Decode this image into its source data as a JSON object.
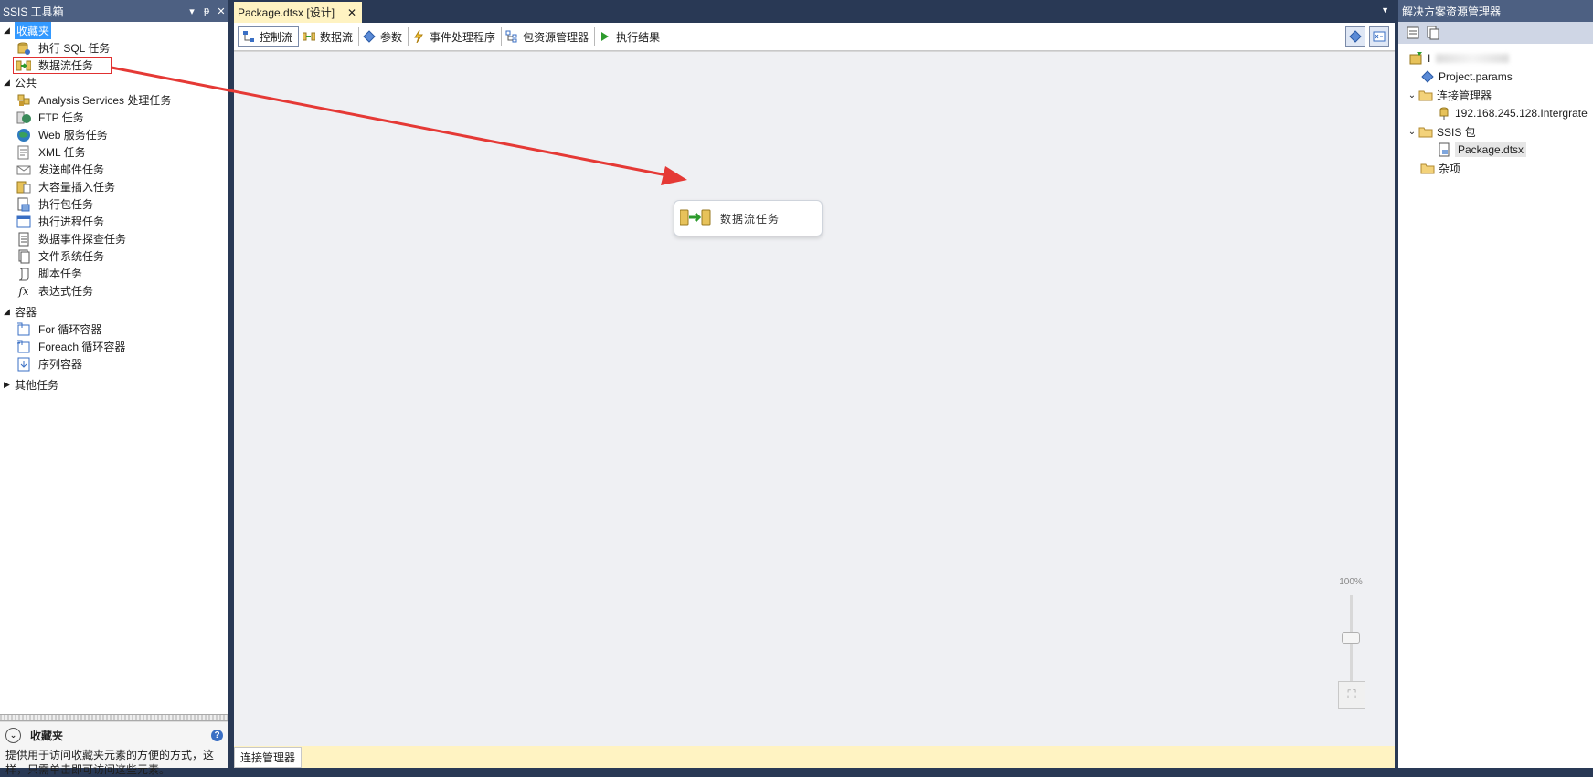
{
  "toolbox": {
    "title": "SSIS 工具箱",
    "favorites": {
      "label": "收藏夹",
      "items": [
        {
          "label": "执行 SQL 任务",
          "icon": "sql-task-icon"
        },
        {
          "label": "数据流任务",
          "icon": "data-flow-task-icon"
        }
      ]
    },
    "common": {
      "label": "公共",
      "items": [
        {
          "label": "Analysis Services 处理任务",
          "icon": "analysis-services-icon"
        },
        {
          "label": "FTP 任务",
          "icon": "ftp-icon"
        },
        {
          "label": "Web 服务任务",
          "icon": "web-service-icon"
        },
        {
          "label": "XML 任务",
          "icon": "xml-icon"
        },
        {
          "label": "发送邮件任务",
          "icon": "mail-icon"
        },
        {
          "label": "大容量插入任务",
          "icon": "bulk-insert-icon"
        },
        {
          "label": "执行包任务",
          "icon": "execute-package-icon"
        },
        {
          "label": "执行进程任务",
          "icon": "execute-process-icon"
        },
        {
          "label": "数据事件探查任务",
          "icon": "data-profiling-icon"
        },
        {
          "label": "文件系统任务",
          "icon": "file-system-icon"
        },
        {
          "label": "脚本任务",
          "icon": "script-icon"
        },
        {
          "label": "表达式任务",
          "icon": "expression-icon"
        }
      ]
    },
    "containers": {
      "label": "容器",
      "items": [
        {
          "label": "For 循环容器",
          "icon": "for-loop-icon"
        },
        {
          "label": "Foreach 循环容器",
          "icon": "foreach-loop-icon"
        },
        {
          "label": "序列容器",
          "icon": "sequence-container-icon"
        }
      ]
    },
    "other": {
      "label": "其他任务"
    },
    "description": {
      "title": "收藏夹",
      "text": "提供用于访问收藏夹元素的方便的方式，这样，只需单击即可访问这些元素。"
    }
  },
  "document": {
    "tab_title": "Package.dtsx [设计]",
    "designer_tabs": [
      {
        "label": "控制流",
        "icon": "control-flow-icon",
        "active": true
      },
      {
        "label": "数据流",
        "icon": "data-flow-icon"
      },
      {
        "label": "参数",
        "icon": "parameters-icon"
      },
      {
        "label": "事件处理程序",
        "icon": "event-handler-icon"
      },
      {
        "label": "包资源管理器",
        "icon": "package-explorer-icon"
      },
      {
        "label": "执行结果",
        "icon": "execution-results-icon"
      }
    ],
    "task_node_label": "数据流任务",
    "zoom_label": "100%",
    "connection_managers_tab": "连接管理器"
  },
  "solution_explorer": {
    "title": "解决方案资源管理器",
    "project_name_prefix": "I",
    "items": {
      "project_params": "Project.params",
      "connection_managers": "连接管理器",
      "connection": "192.168.245.128.Intergrate",
      "ssis_packages": "SSIS 包",
      "package": "Package.dtsx",
      "misc": "杂项"
    }
  },
  "colors": {
    "title_bar": "#4d6082",
    "background": "#293955",
    "selection": "#3399ff",
    "active_tab": "#fff3c2",
    "annotation": "#e53935"
  }
}
